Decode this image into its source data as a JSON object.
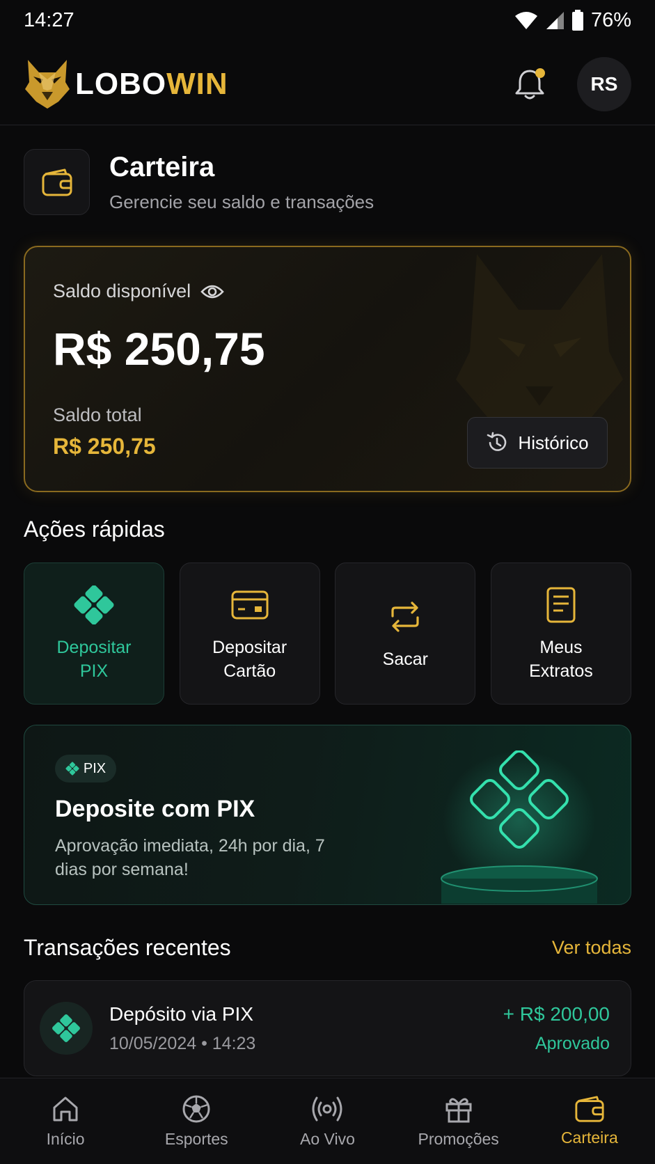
{
  "status_bar": {
    "time": "14:27",
    "battery": "76%"
  },
  "header": {
    "brand_part1": "LOBO",
    "brand_part2": "WIN",
    "avatar_initials": "RS",
    "has_notification": true
  },
  "page": {
    "title": "Carteira",
    "subtitle": "Gerencie seu saldo e transações"
  },
  "balance": {
    "available_label": "Saldo disponível",
    "available_amount": "R$ 250,75",
    "total_label": "Saldo total",
    "total_amount": "R$ 250,75",
    "history_button": "Histórico"
  },
  "quick_actions": {
    "title": "Ações rápidas",
    "items": [
      {
        "label": "Depositar\nPIX",
        "icon": "pix-icon",
        "active": true
      },
      {
        "label": "Depositar\nCartão",
        "icon": "credit-card-icon",
        "active": false
      },
      {
        "label": "Sacar",
        "icon": "transfer-icon",
        "active": false
      },
      {
        "label": "Meus\nExtratos",
        "icon": "document-icon",
        "active": false
      }
    ]
  },
  "pix_banner": {
    "tag": "PIX",
    "title": "Deposite com PIX",
    "description": "Aprovação imediata, 24h por dia, 7 dias por semana!"
  },
  "transactions": {
    "title": "Transações recentes",
    "see_all": "Ver todas",
    "items": [
      {
        "name": "Depósito via PIX",
        "datetime": "10/05/2024 • 14:23",
        "amount": "+ R$ 200,00",
        "status": "Aprovado"
      }
    ]
  },
  "bottom_nav": {
    "items": [
      {
        "label": "Início",
        "icon": "home-icon"
      },
      {
        "label": "Esportes",
        "icon": "soccer-ball-icon"
      },
      {
        "label": "Ao Vivo",
        "icon": "live-broadcast-icon"
      },
      {
        "label": "Promoções",
        "icon": "gift-icon"
      },
      {
        "label": "Carteira",
        "icon": "wallet-icon"
      }
    ],
    "active_index": 4
  },
  "colors": {
    "accent": "#e6b63a",
    "pix_green": "#2fc79b",
    "background": "#0a0a0b"
  }
}
